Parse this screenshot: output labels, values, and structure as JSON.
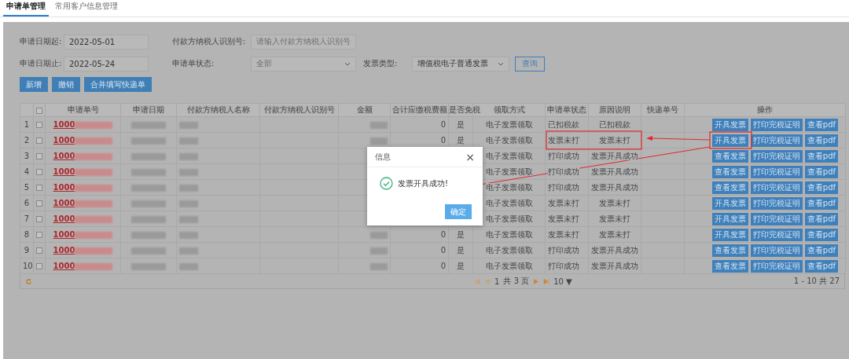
{
  "tabs": [
    {
      "label": "申请单管理",
      "selected": true
    },
    {
      "label": "常用客户信息管理",
      "selected": false
    }
  ],
  "filters": {
    "start_label": "申请日期起:",
    "start_value": "2022-05-01",
    "end_label": "申请日期止:",
    "end_value": "2022-05-24",
    "payer_id_label": "付款方纳税人识别号:",
    "payer_id_placeholder": "请输入付款方纳税人识别号",
    "status_label": "申请单状态:",
    "status_value": "全部",
    "invoice_type_label": "发票类型:",
    "invoice_type_value": "增值税电子普通发票",
    "search_button": "查询"
  },
  "actions": [
    "新增",
    "撤销",
    "合并填写快递单"
  ],
  "table": {
    "all_checked": false,
    "columns": [
      "申请单号",
      "申请日期",
      "付款方纳税人名称",
      "付款方纳税人识别号",
      "金额",
      "合计应缴税费额",
      "是否免税",
      "领取方式",
      "申请单状态",
      "原因说明",
      "快递单号",
      "操作"
    ],
    "rows": [
      {
        "index": "1",
        "checked": false,
        "order": "1000",
        "tax": "0",
        "exempt": "是",
        "method": "电子发票领取",
        "status": "已扣税款",
        "reason": "已扣税款",
        "buttons": [
          "开具发票",
          "打印完税证明",
          "查看pdf"
        ]
      },
      {
        "index": "2",
        "checked": false,
        "order": "1000",
        "tax": "0",
        "exempt": "是",
        "method": "电子发票领取",
        "status": "发票未打",
        "reason": "发票未打",
        "buttons": [
          "开具发票",
          "打印完税证明",
          "查看pdf"
        ]
      },
      {
        "index": "3",
        "checked": false,
        "order": "1000",
        "method": "电子发票领取",
        "status": "打印成功",
        "reason": "发票开具成功",
        "buttons": [
          "查看发票",
          "打印完税证明",
          "查看pdf"
        ]
      },
      {
        "index": "4",
        "checked": false,
        "order": "1000",
        "method": "电子发票领取",
        "status": "打印成功",
        "reason": "发票开具成功",
        "buttons": [
          "查看发票",
          "打印完税证明",
          "查看pdf"
        ]
      },
      {
        "index": "5",
        "checked": false,
        "order": "1000",
        "method": "电子发票领取",
        "status": "打印成功",
        "reason": "发票开具成功",
        "buttons": [
          "查看发票",
          "打印完税证明",
          "查看pdf"
        ]
      },
      {
        "index": "6",
        "checked": false,
        "order": "1000",
        "method": "电子发票领取",
        "status": "发票未打",
        "reason": "发票未打",
        "buttons": [
          "开具发票",
          "打印完税证明",
          "查看pdf"
        ]
      },
      {
        "index": "7",
        "checked": false,
        "order": "1000",
        "method": "电子发票领取",
        "status": "发票未打",
        "reason": "发票未打",
        "buttons": [
          "开具发票",
          "打印完税证明",
          "查看pdf"
        ]
      },
      {
        "index": "8",
        "checked": false,
        "order": "1000",
        "tax": "0",
        "exempt": "是",
        "method": "电子发票领取",
        "status": "发票未打",
        "reason": "发票未打",
        "buttons": [
          "开具发票",
          "打印完税证明",
          "查看pdf"
        ]
      },
      {
        "index": "9",
        "checked": false,
        "order": "1000",
        "tax": "0",
        "exempt": "是",
        "method": "电子发票领取",
        "status": "打印成功",
        "reason": "发票开具成功",
        "buttons": [
          "查看发票",
          "打印完税证明",
          "查看pdf"
        ]
      },
      {
        "index": "10",
        "checked": false,
        "order": "1000",
        "tax": "0",
        "exempt": "是",
        "method": "电子发票领取",
        "status": "打印成功",
        "reason": "发票开具成功",
        "buttons": [
          "查看发票",
          "打印完税证明",
          "查看pdf"
        ]
      }
    ]
  },
  "pager": {
    "page": "1",
    "pages": "共 3 页",
    "page_size": "10 ▼",
    "range": "1 - 10  共 27"
  },
  "dialog": {
    "title": "信息",
    "close": "×",
    "message": "发票开具成功!",
    "ok": "确定"
  }
}
